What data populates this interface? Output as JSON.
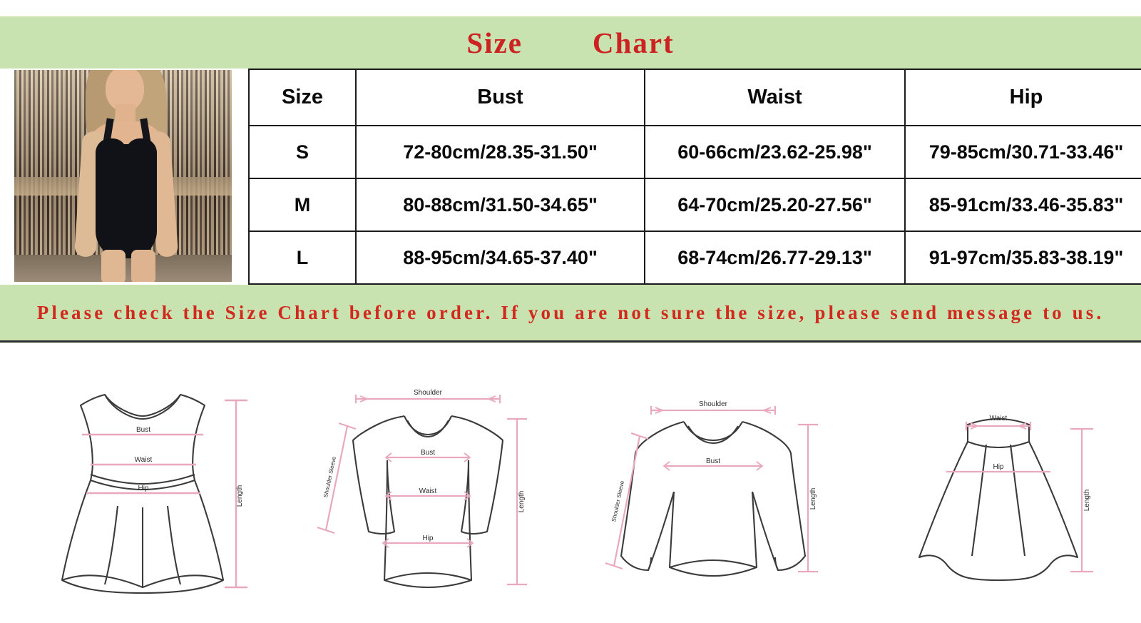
{
  "title": {
    "text": "Size        Chart",
    "color": "#cc2222",
    "band_color": "#c9e3b0"
  },
  "product_photo": {
    "alt": "model-wearing-black-one-piece-swimsuit",
    "background": "bamboo-fence"
  },
  "size_table": {
    "columns": [
      "Size",
      "Bust",
      "Waist",
      "Hip"
    ],
    "rows": [
      {
        "size": "S",
        "bust": "72-80cm/28.35-31.50\"",
        "waist": "60-66cm/23.62-25.98\"",
        "hip": "79-85cm/30.71-33.46\""
      },
      {
        "size": "M",
        "bust": "80-88cm/31.50-34.65\"",
        "waist": "64-70cm/25.20-27.56\"",
        "hip": "85-91cm/33.46-35.83\""
      },
      {
        "size": "L",
        "bust": "88-95cm/34.65-37.40\"",
        "waist": "68-74cm/26.77-29.13\"",
        "hip": "91-97cm/35.83-38.19\""
      }
    ]
  },
  "note": {
    "text": "Please check the Size Chart before order. If you are not sure the size, please send message to us.",
    "color": "#d2291f",
    "band_color": "#c9e3b0"
  },
  "diagrams": {
    "measure_line_color": "#e8a8bd",
    "outline_color": "#3b3b3b",
    "items": [
      {
        "name": "skater-dress",
        "labels": {
          "bust": "Bust",
          "waist": "Waist",
          "hip": "Hip",
          "length": "Length"
        }
      },
      {
        "name": "long-sleeve-dress",
        "labels": {
          "shoulder": "Shoulder",
          "sleeve": "Shoulder Sleeve",
          "bust": "Bust",
          "waist": "Waist",
          "hip": "Hip",
          "length": "Length"
        }
      },
      {
        "name": "sweatshirt",
        "labels": {
          "shoulder": "Shoulder",
          "sleeve": "Shoulder Sleeve",
          "bust": "Bust",
          "length": "Length"
        }
      },
      {
        "name": "a-line-skirt",
        "labels": {
          "waist": "Waist",
          "hip": "Hip",
          "length": "Length"
        }
      }
    ]
  }
}
